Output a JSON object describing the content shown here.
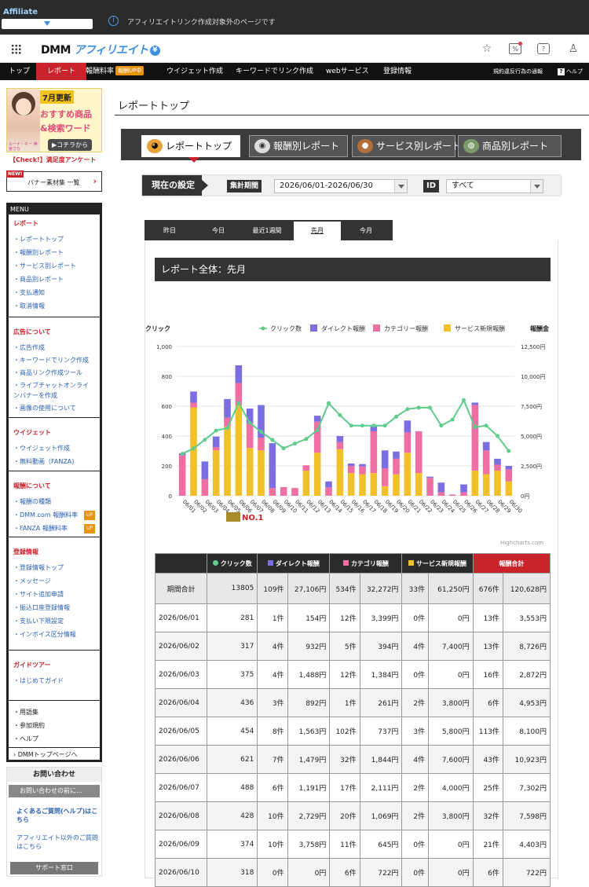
{
  "topstrip": {
    "app_label": "Affiliate",
    "info_text": "アフィリエイトリンク作成対象外のページです"
  },
  "header": {
    "logo_dmm": "DMM",
    "logo_aff": "アフィリエイト",
    "logo_yen": "¥"
  },
  "nav": {
    "items": [
      "トップ",
      "レポート",
      "報酬料率",
      "ウイジェット作成",
      "キーワードでリンク作成",
      "webサービス",
      "登録情報"
    ],
    "badge": "報酬UP中",
    "right1": "規約違反行為の通報",
    "right2": "ヘルプ",
    "help_icon": "?"
  },
  "sidebar": {
    "banner": {
      "month": "7月更新",
      "line1": "おすすめ商品",
      "line2": "&検索ワード",
      "button": "▶コチラから",
      "caption": "ルーナ・ギー 神宮さな"
    },
    "check": "【Check!】満足度アンケート",
    "material": {
      "new": "NEW!",
      "label": "バナー素材集 一覧",
      "chevron": "›"
    },
    "menu_title": "MENU",
    "sections": [
      {
        "title": "レポート",
        "links": [
          "レポートトップ",
          "報酬別レポート",
          "サービス別レポート",
          "商品別レポート",
          "支払通知",
          "取消情報"
        ]
      },
      {
        "title": "広告について",
        "links": [
          "広告作成",
          "キーワードでリンク作成",
          "商品リンク作成ツール",
          "ライブチャットオンライ",
          "ンバナーを作成",
          "画像の使用について"
        ]
      },
      {
        "title": "ウイジェット",
        "links": [
          "ウイジェット作成",
          "無料動画（FANZA)"
        ]
      },
      {
        "title": "報酬について",
        "links": [
          "報酬の種類",
          "DMM.com 報酬料率",
          "FANZA 報酬料率"
        ]
      },
      {
        "title": "登録情報",
        "links": [
          "登録情報トップ",
          "メッセージ",
          "サイト追加申請",
          "振込口座登録情報",
          "支払い下限設定",
          "インボイス区分情報"
        ]
      },
      {
        "title": "ガイドツアー",
        "links": [
          "はじめてガイド"
        ]
      }
    ],
    "extra_links": [
      "用語集",
      "参加規約",
      "ヘルプ"
    ],
    "dmm_top": "DMMトップページへ",
    "up_badge": "UP",
    "contact": {
      "title": "お問い合わせ",
      "pre": "お問い合わせの前に…",
      "faq": "よくあるご質問(ヘルプ)はこちら",
      "other": "アフィリエイト以外のご質問はこちら",
      "support": "サポート窓口"
    }
  },
  "main": {
    "title": "レポートトップ",
    "tabs": [
      "レポートトップ",
      "報酬別レポート",
      "サービス別レポート",
      "商品別レポート"
    ],
    "settings": {
      "header": "現在の設定",
      "period_label": "集計期間",
      "period_value": "2026/06/01-2026/06/30",
      "id_label": "ID",
      "id_value": "すべて"
    },
    "period_tabs": [
      "昨日",
      "今日",
      "最近1週間",
      "先月",
      "今月"
    ],
    "report_title": "レポート全体：先月",
    "no1_label": "NO.1",
    "credit": "Highcharts.com"
  },
  "chart_data": {
    "type": "bar",
    "yleft_label": "クリック",
    "yright_label": "報酬金",
    "yleft_ticks": [
      "0",
      "200",
      "400",
      "600",
      "800",
      "1,000"
    ],
    "yright_ticks": [
      "0円",
      "2,500円",
      "5,000円",
      "7,500円",
      "10,000円",
      "12,500円"
    ],
    "ylim_left": [
      0,
      1000
    ],
    "ylim_right": [
      0,
      12500
    ],
    "legend_position": "top-right",
    "categories": [
      "06/01",
      "06/02",
      "06/03",
      "06/04",
      "06/05",
      "06/06",
      "06/07",
      "06/08",
      "06/09",
      "06/10",
      "06/11",
      "06/12",
      "06/13",
      "06/14",
      "06/15",
      "06/16",
      "06/17",
      "06/18",
      "06/19",
      "06/20",
      "06/21",
      "06/22",
      "06/23",
      "06/24",
      "06/25",
      "06/26",
      "06/27",
      "06/28",
      "06/29",
      "06/30"
    ],
    "series": [
      {
        "name": "クリック数",
        "type": "line",
        "color": "#5dcc8c",
        "values": [
          281,
          317,
          375,
          436,
          454,
          621,
          488,
          428,
          374,
          318,
          350,
          380,
          440,
          620,
          540,
          470,
          470,
          470,
          470,
          530,
          580,
          590,
          590,
          470,
          510,
          640,
          460,
          470,
          400,
          300
        ]
      },
      {
        "name": "ダイレクト報酬",
        "type": "bar",
        "color": "#7b6ee0",
        "values": [
          154,
          932,
          1488,
          892,
          1563,
          1479,
          1191,
          2729,
          3758,
          0,
          0,
          0,
          500,
          500,
          500,
          200,
          200,
          400,
          1500,
          600,
          1000,
          0,
          100,
          800,
          0,
          650,
          200,
          700,
          500,
          300
        ]
      },
      {
        "name": "カテゴリー報酬",
        "type": "bar",
        "color": "#ee6fa2",
        "values": [
          3399,
          394,
          1384,
          261,
          737,
          1844,
          2111,
          1069,
          645,
          722,
          650,
          450,
          2600,
          700,
          600,
          600,
          650,
          3500,
          1500,
          1300,
          1700,
          3500,
          1500,
          300,
          100,
          300,
          5500,
          2000,
          500,
          1000
        ]
      },
      {
        "name": "サービス新規報酬",
        "type": "bar",
        "color": "#f0c12b",
        "values": [
          0,
          7400,
          0,
          3800,
          5800,
          7600,
          4000,
          3800,
          0,
          0,
          0,
          2100,
          3600,
          0,
          3900,
          1900,
          1800,
          1900,
          800,
          1800,
          3600,
          1900,
          0,
          0,
          0,
          0,
          2100,
          1800,
          2100,
          1200
        ]
      }
    ]
  },
  "table": {
    "headers": [
      "クリック数",
      "ダイレクト報酬",
      "カテゴリ報酬",
      "サービス新規報酬",
      "報酬合計"
    ],
    "sum": {
      "label": "期間合計",
      "clicks": "13805",
      "d_count": "109件",
      "d_amt": "27,106円",
      "c_count": "534件",
      "c_amt": "32,272円",
      "s_count": "33件",
      "s_amt": "61,250円",
      "t_count": "676件",
      "t_amt": "120,628円"
    },
    "rows": [
      [
        "2026/06/01",
        "281",
        "1件",
        "154円",
        "12件",
        "3,399円",
        "0件",
        "0円",
        "13件",
        "3,553円"
      ],
      [
        "2026/06/02",
        "317",
        "4件",
        "932円",
        "5件",
        "394円",
        "4件",
        "7,400円",
        "13件",
        "8,726円"
      ],
      [
        "2026/06/03",
        "375",
        "4件",
        "1,488円",
        "12件",
        "1,384円",
        "0件",
        "0円",
        "16件",
        "2,872円"
      ],
      [
        "2026/06/04",
        "436",
        "3件",
        "892円",
        "1件",
        "261円",
        "2件",
        "3,800円",
        "6件",
        "4,953円"
      ],
      [
        "2026/06/05",
        "454",
        "8件",
        "1,563円",
        "102件",
        "737円",
        "3件",
        "5,800円",
        "113件",
        "8,100円"
      ],
      [
        "2026/06/06",
        "621",
        "7件",
        "1,479円",
        "32件",
        "1,844円",
        "4件",
        "7,600円",
        "43件",
        "10,923円"
      ],
      [
        "2026/06/07",
        "488",
        "6件",
        "1,191円",
        "17件",
        "2,111円",
        "2件",
        "4,000円",
        "25件",
        "7,302円"
      ],
      [
        "2026/06/08",
        "428",
        "10件",
        "2,729円",
        "20件",
        "1,069円",
        "2件",
        "3,800円",
        "32件",
        "7,598円"
      ],
      [
        "2026/06/09",
        "374",
        "10件",
        "3,758円",
        "11件",
        "645円",
        "0件",
        "0円",
        "21件",
        "4,403円"
      ],
      [
        "2026/06/10",
        "318",
        "0件",
        "0円",
        "6件",
        "722円",
        "0件",
        "0円",
        "6件",
        "722円"
      ]
    ]
  }
}
